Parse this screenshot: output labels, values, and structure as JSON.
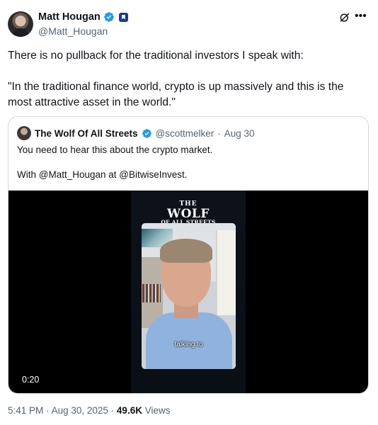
{
  "author": {
    "display_name": "Matt Hougan",
    "handle": "@Matt_Hougan"
  },
  "tweet": {
    "paragraphs": [
      "There is no pullback for the traditional investors I speak with:",
      "\"In the traditional finance world, crypto is up massively and this is the most attractive asset in the world.\""
    ]
  },
  "quote": {
    "display_name": "The Wolf Of All Streets",
    "handle": "@scottmelker",
    "separator": "·",
    "date": "Aug 30",
    "paragraphs": [
      "You need to hear this about the crypto market.",
      "With @Matt_Hougan at @BitwiseInvest."
    ],
    "video": {
      "brand_the": "THE",
      "brand_wolf": "WOLF",
      "brand_streets": "OF ALL STREETS",
      "caption": "talking to",
      "timecode": "0:20"
    }
  },
  "meta": {
    "time": "5:41 PM",
    "separator": "·",
    "date": "Aug 30, 2025",
    "views_count": "49.6K",
    "views_label": "Views"
  },
  "colors": {
    "verified_blue": "#1d9bf0",
    "text_secondary": "#536471",
    "border": "#cfd9de"
  },
  "icons": {
    "verified": "verified-badge-icon",
    "affiliate": "affiliate-badge-icon",
    "grok": "grok-icon",
    "more": "more-icon"
  }
}
